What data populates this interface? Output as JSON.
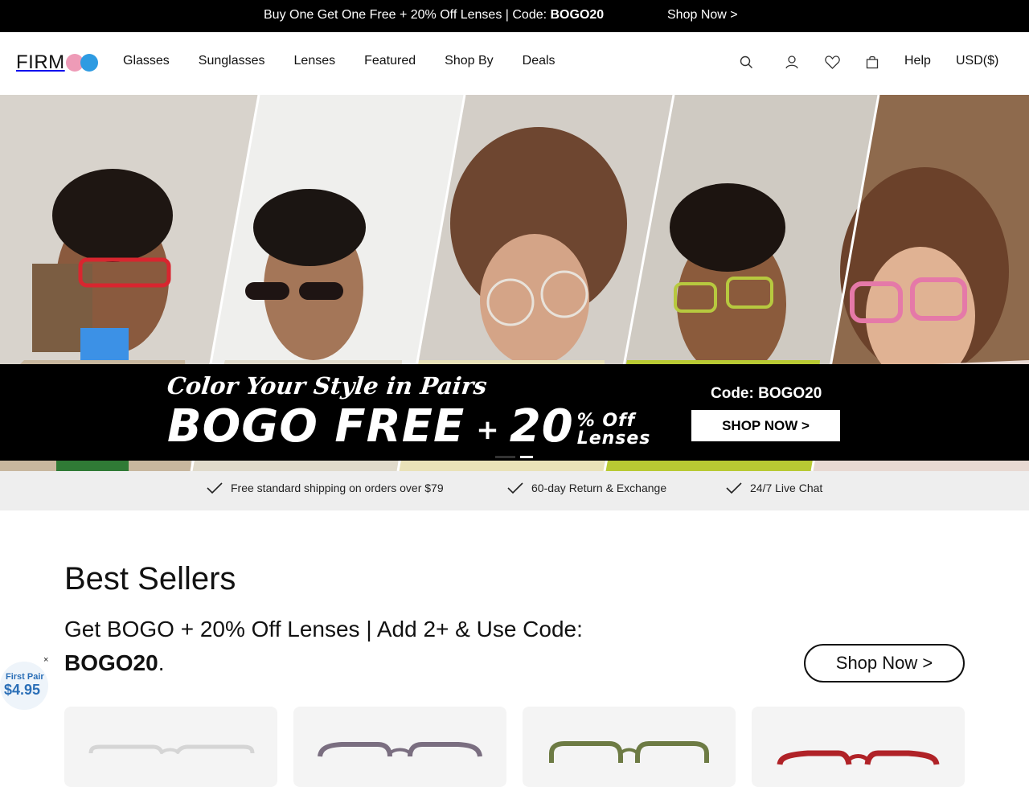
{
  "promo_bar": {
    "text": "Buy One Get One Free + 20% Off Lenses | Code: ",
    "code": "BOGO20",
    "link": "Shop Now >"
  },
  "header": {
    "logo": "FIRM",
    "nav": [
      "Glasses",
      "Sunglasses",
      "Lenses",
      "Featured",
      "Shop By",
      "Deals"
    ],
    "icons": [
      "search-icon",
      "account-icon",
      "heart-icon",
      "bag-icon"
    ],
    "help": "Help",
    "currency": "USD($)"
  },
  "hero": {
    "script": "Color Your Style in Pairs",
    "headline": "BOGO FREE",
    "plus": "+",
    "number": "20",
    "off_top": "% Off",
    "off_bottom": "Lenses",
    "code": "Code: BOGO20",
    "button": "SHOP NOW >",
    "slides": 2,
    "active_slide": 2
  },
  "perks": [
    "Free standard shipping on orders over $79",
    "60-day Return & Exchange",
    "24/7 Live Chat"
  ],
  "best_sellers": {
    "title": "Best Sellers",
    "subtitle": "Get BOGO + 20% Off Lenses | Add 2+ & Use Code:",
    "code": "BOGO20",
    "period": ".",
    "button": "Shop Now >"
  },
  "floater": {
    "close": "×",
    "line1": "First Pair",
    "line2": "$4.95"
  },
  "colors": {
    "black": "#000000",
    "logo_pink": "#ee9bb7",
    "logo_blue": "#2e9be2",
    "perk_bg": "#eeeeee",
    "floater_text": "#2b6fb7"
  }
}
